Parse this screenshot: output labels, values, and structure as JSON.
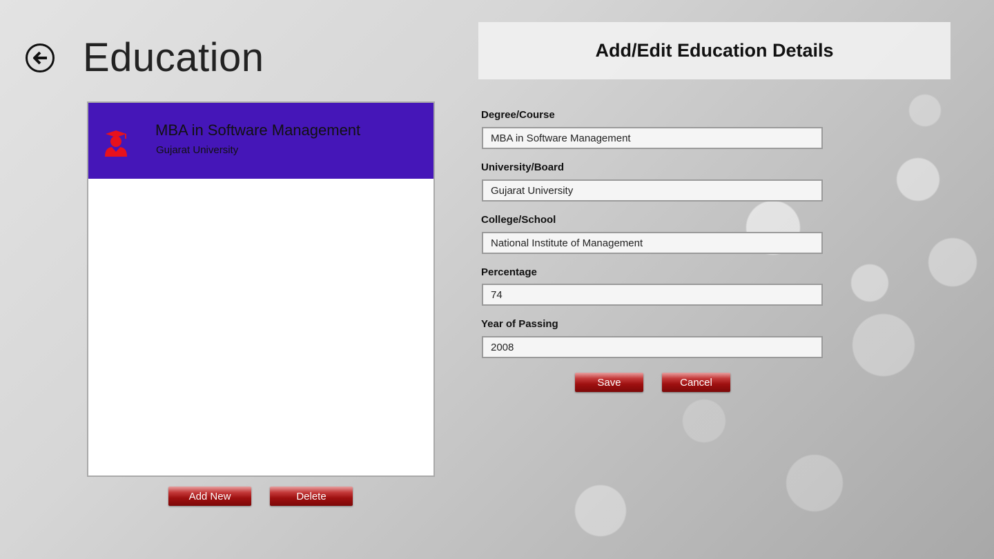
{
  "page": {
    "title": "Education"
  },
  "list": {
    "items": [
      {
        "title": "MBA in Software Management",
        "subtitle": "Gujarat University"
      }
    ],
    "add_label": "Add New",
    "delete_label": "Delete"
  },
  "form": {
    "header": "Add/Edit Education Details",
    "fields": [
      {
        "label": "Degree/Course",
        "value": "MBA in Software Management"
      },
      {
        "label": "University/Board",
        "value": "Gujarat University"
      },
      {
        "label": "College/School",
        "value": "National Institute of Management"
      },
      {
        "label": "Percentage",
        "value": "74"
      },
      {
        "label": "Year of Passing",
        "value": "2008"
      }
    ],
    "save_label": "Save",
    "cancel_label": "Cancel"
  },
  "colors": {
    "selected_item": "#4516b8",
    "button_red": "#9e1010",
    "icon_red": "#e8111c"
  },
  "icons": {
    "back": "back-arrow-icon",
    "item": "graduate-icon"
  }
}
